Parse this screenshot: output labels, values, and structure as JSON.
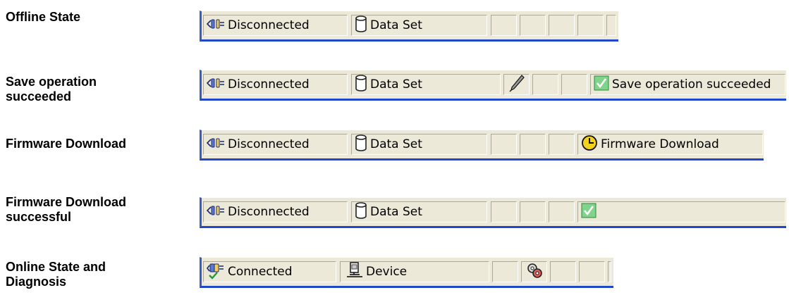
{
  "rows": [
    {
      "label": "Offline State",
      "panes": [
        {
          "icon": "disconnected-plug-icon",
          "text": "Disconnected"
        },
        {
          "icon": "data-set-cylinder-icon",
          "text": "Data Set"
        },
        {
          "icon": "",
          "text": ""
        },
        {
          "icon": "",
          "text": ""
        },
        {
          "icon": "",
          "text": ""
        },
        {
          "icon": "",
          "text": ""
        },
        {
          "icon": "",
          "text": ""
        }
      ]
    },
    {
      "label": "Save operation\nsucceeded",
      "panes": [
        {
          "icon": "disconnected-plug-icon",
          "text": "Disconnected"
        },
        {
          "icon": "data-set-cylinder-icon",
          "text": "Data Set"
        },
        {
          "icon": "pencil-edit-icon",
          "text": ""
        },
        {
          "icon": "",
          "text": ""
        },
        {
          "icon": "",
          "text": ""
        },
        {
          "icon": "green-check-icon",
          "text": "Save operation succeeded"
        }
      ]
    },
    {
      "label": "Firmware Download",
      "panes": [
        {
          "icon": "disconnected-plug-icon",
          "text": "Disconnected"
        },
        {
          "icon": "data-set-cylinder-icon",
          "text": "Data Set"
        },
        {
          "icon": "",
          "text": ""
        },
        {
          "icon": "",
          "text": ""
        },
        {
          "icon": "",
          "text": ""
        },
        {
          "icon": "yellow-clock-icon",
          "text": "Firmware Download"
        }
      ]
    },
    {
      "label": "Firmware Download\nsuccessful",
      "panes": [
        {
          "icon": "disconnected-plug-icon",
          "text": "Disconnected"
        },
        {
          "icon": "data-set-cylinder-icon",
          "text": "Data Set"
        },
        {
          "icon": "",
          "text": ""
        },
        {
          "icon": "",
          "text": ""
        },
        {
          "icon": "",
          "text": ""
        },
        {
          "icon": "green-check-icon",
          "text": ""
        }
      ]
    },
    {
      "label": "Online State and\nDiagnosis",
      "panes": [
        {
          "icon": "connected-plug-check-icon",
          "text": "Connected"
        },
        {
          "icon": "device-icon",
          "text": "Device"
        },
        {
          "icon": "",
          "text": ""
        },
        {
          "icon": "diagnosis-gears-icon",
          "text": ""
        },
        {
          "icon": "",
          "text": ""
        },
        {
          "icon": "",
          "text": ""
        },
        {
          "icon": "",
          "text": ""
        }
      ]
    }
  ]
}
